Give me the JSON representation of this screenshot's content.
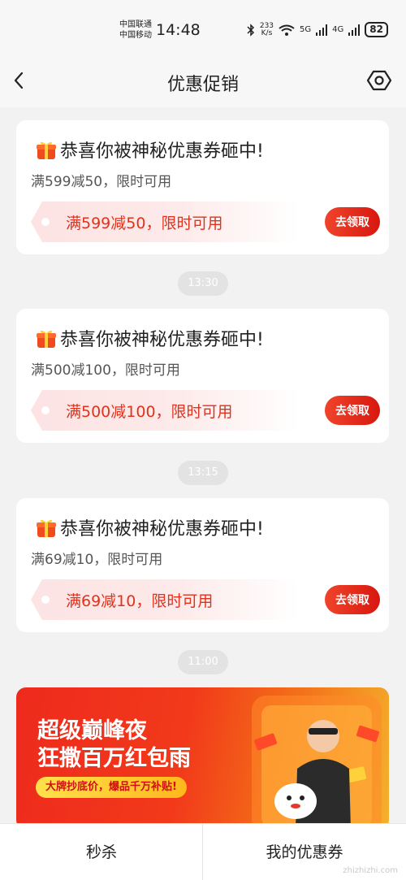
{
  "status_bar": {
    "carrier_1": "中国联通",
    "carrier_2": "中国移动",
    "time": "14:48",
    "speed_value": "233",
    "speed_unit": "K/s",
    "net_1": "5G",
    "net_2": "4G",
    "battery": "82",
    "icons": [
      "bluetooth-icon",
      "wifi-icon",
      "signal-5g-icon",
      "signal-4g-icon",
      "battery-icon"
    ]
  },
  "navbar": {
    "title": "优惠促销",
    "back_icon": "chevron-left-icon",
    "settings_icon": "gear-icon"
  },
  "messages": [
    {
      "title": "恭喜你被神秘优惠券砸中!",
      "subtitle": "满599减50，限时可用",
      "coupon_text": "满599减50，限时可用",
      "button": "去领取"
    },
    {
      "title": "恭喜你被神秘优惠券砸中!",
      "subtitle": "满500减100，限时可用",
      "coupon_text": "满500减100，限时可用",
      "button": "去领取"
    },
    {
      "title": "恭喜你被神秘优惠券砸中!",
      "subtitle": "满69减10，限时可用",
      "coupon_text": "满69减10，限时可用",
      "button": "去领取"
    }
  ],
  "timestamps": [
    "13:30",
    "13:15",
    "11:00"
  ],
  "banner": {
    "headline_1": "超级巅峰夜",
    "headline_2": "狂撒百万红包雨",
    "tag": "大牌抄底价，爆品千万补贴!"
  },
  "bottom_bar": {
    "left": "秒杀",
    "right": "我的优惠券"
  },
  "watermark": "zhizhizhi.com",
  "colors": {
    "accent": "#e0321c",
    "button": "#d7170f",
    "background": "#f2f2f2"
  }
}
